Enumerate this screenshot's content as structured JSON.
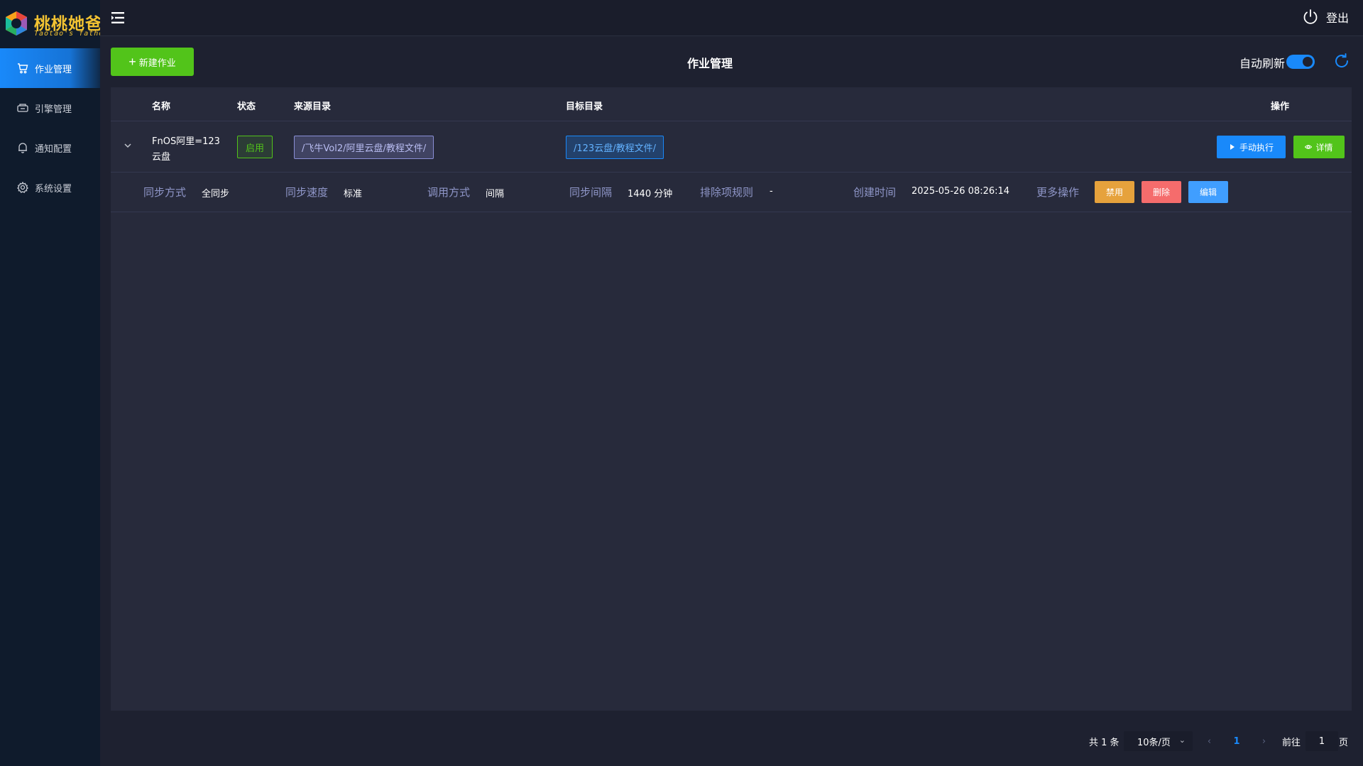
{
  "brand": {
    "title": "桃桃她爸",
    "subtitle": "Taotao's father"
  },
  "sidebar": {
    "items": [
      {
        "label": "作业管理",
        "icon": "cart-icon",
        "active": true
      },
      {
        "label": "引擎管理",
        "icon": "engine-icon",
        "active": false
      },
      {
        "label": "通知配置",
        "icon": "bell-icon",
        "active": false
      },
      {
        "label": "系统设置",
        "icon": "gear-icon",
        "active": false
      }
    ]
  },
  "topbar": {
    "logout_label": "登出"
  },
  "header": {
    "new_job_label": "新建作业",
    "page_title": "作业管理",
    "auto_refresh_label": "自动刷新",
    "auto_refresh_on": true
  },
  "table": {
    "columns": [
      "名称",
      "状态",
      "来源目录",
      "目标目录",
      "操作"
    ],
    "rows": [
      {
        "name": "FnOS阿里=123云盘",
        "status": "启用",
        "source_dir": "/飞牛Vol2/阿里云盘/教程文件/",
        "target_dir": "/123云盘/教程文件/",
        "run_label": "手动执行",
        "detail_label": "详情",
        "details": {
          "sync_mode_label": "同步方式",
          "sync_mode": "全同步",
          "sync_speed_label": "同步速度",
          "sync_speed": "标准",
          "invoke_mode_label": "调用方式",
          "invoke_mode": "间隔",
          "interval_label": "同步间隔",
          "interval": "1440 分钟",
          "exclude_label": "排除项规则",
          "exclude": "-",
          "created_label": "创建时间",
          "created": "2025-05-26 08:26:14",
          "more_label": "更多操作",
          "disable_label": "禁用",
          "delete_label": "删除",
          "edit_label": "编辑"
        }
      }
    ]
  },
  "pagination": {
    "total": "共 1 条",
    "page_size": "10条/页",
    "current_page": "1",
    "goto_label": "前往",
    "goto_value": "1",
    "page_suffix": "页"
  },
  "colors": {
    "accent": "#1989fa",
    "success": "#52c41a",
    "warning": "#e6a23c",
    "danger": "#f56c6c",
    "sidebar_bg": "#0f1b2c",
    "content_bg": "#272a3b"
  }
}
